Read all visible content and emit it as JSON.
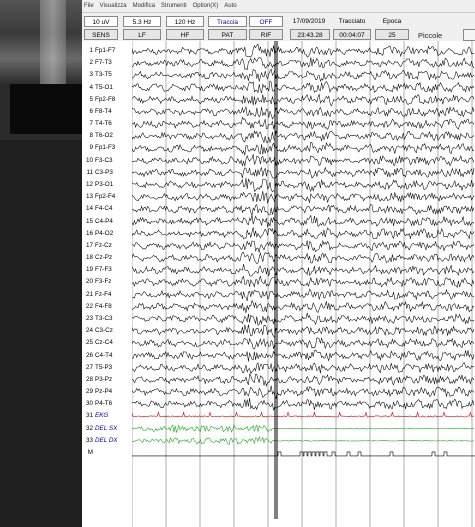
{
  "menu": [
    "File",
    "Visualizza",
    "Modifica",
    "Strumenti",
    "Option(X)",
    "Auto"
  ],
  "toolbar": {
    "row1": [
      {
        "label": "10 uV",
        "blue": false,
        "framed": true
      },
      {
        "label": "5.3 Hz",
        "blue": false,
        "framed": true
      },
      {
        "label": "120 Hz",
        "blue": false,
        "framed": true
      },
      {
        "label": "Traccia",
        "blue": true,
        "framed": true
      },
      {
        "label": "OFF",
        "blue": true,
        "framed": true
      },
      {
        "label": "17/09/2019",
        "blue": false,
        "framed": false
      },
      {
        "label": "Tracciato",
        "blue": false,
        "framed": false
      },
      {
        "label": "Epoca",
        "blue": false,
        "framed": false
      }
    ],
    "row2": [
      {
        "label": "SENS",
        "blue": false
      },
      {
        "label": "LF",
        "blue": false
      },
      {
        "label": "HF",
        "blue": false
      },
      {
        "label": "PAT",
        "blue": false
      },
      {
        "label": "RIF",
        "blue": false
      },
      {
        "label": "23:43.28",
        "blue": false
      },
      {
        "label": "00:04:07",
        "blue": false
      },
      {
        "label": "25",
        "blue": false
      }
    ],
    "size_label": "Piccole"
  },
  "channels": [
    {
      "num": "1",
      "name": "Fp1-F7"
    },
    {
      "num": "2",
      "name": "F7-T3"
    },
    {
      "num": "3",
      "name": "T3-T5"
    },
    {
      "num": "4",
      "name": "T5-O1"
    },
    {
      "num": "5",
      "name": "Fp2-F8"
    },
    {
      "num": "6",
      "name": "F8-T4"
    },
    {
      "num": "7",
      "name": "T4-T6"
    },
    {
      "num": "8",
      "name": "T6-O2"
    },
    {
      "num": "9",
      "name": "Fp1-F3"
    },
    {
      "num": "10",
      "name": "F3-C3"
    },
    {
      "num": "11",
      "name": "C3-P3"
    },
    {
      "num": "12",
      "name": "P3-O1"
    },
    {
      "num": "13",
      "name": "Fp2-F4"
    },
    {
      "num": "14",
      "name": "F4-C4"
    },
    {
      "num": "15",
      "name": "C4-P4"
    },
    {
      "num": "16",
      "name": "P4-O2"
    },
    {
      "num": "17",
      "name": "Fz-Cz"
    },
    {
      "num": "18",
      "name": "Cz-Pz"
    },
    {
      "num": "19",
      "name": "F7-F3"
    },
    {
      "num": "20",
      "name": "F3-Fz"
    },
    {
      "num": "21",
      "name": "Fz-F4"
    },
    {
      "num": "22",
      "name": "F4-F8"
    },
    {
      "num": "23",
      "name": "T3-C3"
    },
    {
      "num": "24",
      "name": "C3-Cz"
    },
    {
      "num": "25",
      "name": "Cz-C4"
    },
    {
      "num": "26",
      "name": "C4-T4"
    },
    {
      "num": "27",
      "name": "T5-P3"
    },
    {
      "num": "28",
      "name": "P3-Pz"
    },
    {
      "num": "29",
      "name": "Pz-P4"
    },
    {
      "num": "30",
      "name": "P4-T6"
    },
    {
      "num": "31",
      "name": "EKG",
      "special": true
    },
    {
      "num": "32",
      "name": "DEL SX",
      "special": true
    },
    {
      "num": "33",
      "name": "DEL DX",
      "special": true
    },
    {
      "num": "M",
      "name": "",
      "special": false
    }
  ],
  "colors": {
    "eeg": "#000000",
    "ekg": "#cc0000",
    "emg": "#22aa22",
    "grid": "#7a7a7a",
    "marker": "#000000",
    "label_special": "#0000c8"
  }
}
